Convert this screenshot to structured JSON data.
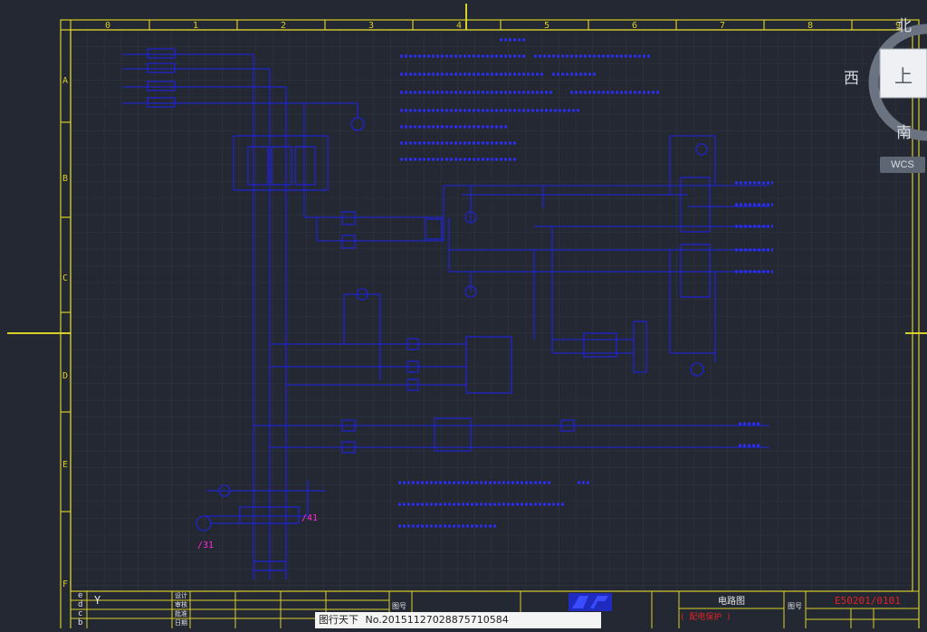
{
  "colors": {
    "background": "#232833",
    "grid": "#2f3541",
    "frame": "#d8cf2a",
    "circuit": "#1f22e8",
    "circuit_text": "#3a3cf2",
    "accent_red": "#e02424",
    "accent_magenta": "#ff2bd6",
    "white_text": "#e6e6e6"
  },
  "column_numbers": [
    "0",
    "1",
    "2",
    "3",
    "4",
    "5",
    "6",
    "7",
    "8",
    "9"
  ],
  "row_letters": [
    "A",
    "B",
    "C",
    "D",
    "E",
    "F"
  ],
  "viewcube": {
    "north": "北",
    "west": "西",
    "south": "南",
    "top": "上",
    "wcs": "WCS"
  },
  "title_block": {
    "rows": [
      "e",
      "d",
      "c",
      "b"
    ],
    "left_marks": [
      "设计",
      "审核",
      "批准",
      "日期"
    ],
    "stamp": "图号",
    "sheet_title": "电路图",
    "subtitle": "(  配电保护  )",
    "drawing_no_label": "图号",
    "drawing_no": "E50201/0101"
  },
  "watermark": {
    "site": "图行天下",
    "id_text": "No.20151127028875710584"
  },
  "pink_tags": [
    "/31",
    "/41"
  ]
}
